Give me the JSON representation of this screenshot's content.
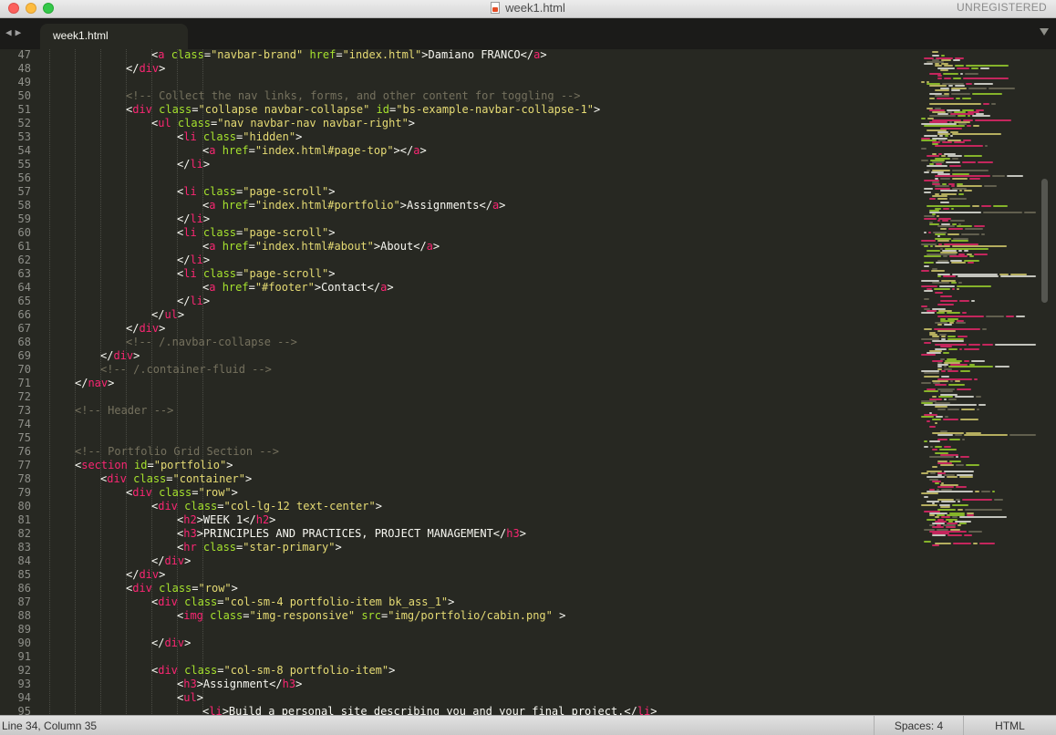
{
  "window": {
    "title": "week1.html",
    "license_status": "UNREGISTERED"
  },
  "tabs": [
    {
      "label": "week1.html",
      "active": true
    }
  ],
  "editor": {
    "lines": [
      {
        "num": "47",
        "indent": 4,
        "tokens": [
          [
            "p",
            "<"
          ],
          [
            "t",
            "a"
          ],
          [
            "a",
            " class"
          ],
          [
            "p",
            "="
          ],
          [
            "s",
            "\"navbar-brand\""
          ],
          [
            "a",
            " href"
          ],
          [
            "p",
            "="
          ],
          [
            "s",
            "\"index.html\""
          ],
          [
            "p",
            ">Damiano FRANCO</"
          ],
          [
            "t",
            "a"
          ],
          [
            "p",
            ">"
          ]
        ]
      },
      {
        "num": "48",
        "indent": 3,
        "tokens": [
          [
            "p",
            "</"
          ],
          [
            "t",
            "div"
          ],
          [
            "p",
            ">"
          ]
        ]
      },
      {
        "num": "49",
        "indent": 0,
        "tokens": []
      },
      {
        "num": "50",
        "indent": 3,
        "tokens": [
          [
            "c",
            "<!-- Collect the nav links, forms, and other content for toggling -->"
          ]
        ]
      },
      {
        "num": "51",
        "indent": 3,
        "tokens": [
          [
            "p",
            "<"
          ],
          [
            "t",
            "div"
          ],
          [
            "a",
            " class"
          ],
          [
            "p",
            "="
          ],
          [
            "s",
            "\"collapse navbar-collapse\""
          ],
          [
            "a",
            " id"
          ],
          [
            "p",
            "="
          ],
          [
            "s",
            "\"bs-example-navbar-collapse-1\""
          ],
          [
            "p",
            ">"
          ]
        ]
      },
      {
        "num": "52",
        "indent": 4,
        "tokens": [
          [
            "p",
            "<"
          ],
          [
            "t",
            "ul"
          ],
          [
            "a",
            " class"
          ],
          [
            "p",
            "="
          ],
          [
            "s",
            "\"nav navbar-nav navbar-right\""
          ],
          [
            "p",
            ">"
          ]
        ]
      },
      {
        "num": "53",
        "indent": 5,
        "tokens": [
          [
            "p",
            "<"
          ],
          [
            "t",
            "li"
          ],
          [
            "a",
            " class"
          ],
          [
            "p",
            "="
          ],
          [
            "s",
            "\"hidden\""
          ],
          [
            "p",
            ">"
          ]
        ]
      },
      {
        "num": "54",
        "indent": 6,
        "tokens": [
          [
            "p",
            "<"
          ],
          [
            "t",
            "a"
          ],
          [
            "a",
            " href"
          ],
          [
            "p",
            "="
          ],
          [
            "s",
            "\"index.html#page-top\""
          ],
          [
            "p",
            "></"
          ],
          [
            "t",
            "a"
          ],
          [
            "p",
            ">"
          ]
        ]
      },
      {
        "num": "55",
        "indent": 5,
        "tokens": [
          [
            "p",
            "</"
          ],
          [
            "t",
            "li"
          ],
          [
            "p",
            ">"
          ]
        ]
      },
      {
        "num": "56",
        "indent": 0,
        "tokens": []
      },
      {
        "num": "57",
        "indent": 5,
        "tokens": [
          [
            "p",
            "<"
          ],
          [
            "t",
            "li"
          ],
          [
            "a",
            " class"
          ],
          [
            "p",
            "="
          ],
          [
            "s",
            "\"page-scroll\""
          ],
          [
            "p",
            ">"
          ]
        ]
      },
      {
        "num": "58",
        "indent": 6,
        "tokens": [
          [
            "p",
            "<"
          ],
          [
            "t",
            "a"
          ],
          [
            "a",
            " href"
          ],
          [
            "p",
            "="
          ],
          [
            "s",
            "\"index.html#portfolio\""
          ],
          [
            "p",
            ">Assignments</"
          ],
          [
            "t",
            "a"
          ],
          [
            "p",
            ">"
          ]
        ]
      },
      {
        "num": "59",
        "indent": 5,
        "tokens": [
          [
            "p",
            "</"
          ],
          [
            "t",
            "li"
          ],
          [
            "p",
            ">"
          ]
        ]
      },
      {
        "num": "60",
        "indent": 5,
        "tokens": [
          [
            "p",
            "<"
          ],
          [
            "t",
            "li"
          ],
          [
            "a",
            " class"
          ],
          [
            "p",
            "="
          ],
          [
            "s",
            "\"page-scroll\""
          ],
          [
            "p",
            ">"
          ]
        ]
      },
      {
        "num": "61",
        "indent": 6,
        "tokens": [
          [
            "p",
            "<"
          ],
          [
            "t",
            "a"
          ],
          [
            "a",
            " href"
          ],
          [
            "p",
            "="
          ],
          [
            "s",
            "\"index.html#about\""
          ],
          [
            "p",
            ">About</"
          ],
          [
            "t",
            "a"
          ],
          [
            "p",
            ">"
          ]
        ]
      },
      {
        "num": "62",
        "indent": 5,
        "tokens": [
          [
            "p",
            "</"
          ],
          [
            "t",
            "li"
          ],
          [
            "p",
            ">"
          ]
        ]
      },
      {
        "num": "63",
        "indent": 5,
        "tokens": [
          [
            "p",
            "<"
          ],
          [
            "t",
            "li"
          ],
          [
            "a",
            " class"
          ],
          [
            "p",
            "="
          ],
          [
            "s",
            "\"page-scroll\""
          ],
          [
            "p",
            ">"
          ]
        ]
      },
      {
        "num": "64",
        "indent": 6,
        "tokens": [
          [
            "p",
            "<"
          ],
          [
            "t",
            "a"
          ],
          [
            "a",
            " href"
          ],
          [
            "p",
            "="
          ],
          [
            "s",
            "\"#footer\""
          ],
          [
            "p",
            ">Contact</"
          ],
          [
            "t",
            "a"
          ],
          [
            "p",
            ">"
          ]
        ]
      },
      {
        "num": "65",
        "indent": 5,
        "tokens": [
          [
            "p",
            "</"
          ],
          [
            "t",
            "li"
          ],
          [
            "p",
            ">"
          ]
        ]
      },
      {
        "num": "66",
        "indent": 4,
        "tokens": [
          [
            "p",
            "</"
          ],
          [
            "t",
            "ul"
          ],
          [
            "p",
            ">"
          ]
        ]
      },
      {
        "num": "67",
        "indent": 3,
        "tokens": [
          [
            "p",
            "</"
          ],
          [
            "t",
            "div"
          ],
          [
            "p",
            ">"
          ]
        ]
      },
      {
        "num": "68",
        "indent": 3,
        "tokens": [
          [
            "c",
            "<!-- /.navbar-collapse -->"
          ]
        ]
      },
      {
        "num": "69",
        "indent": 2,
        "tokens": [
          [
            "p",
            "</"
          ],
          [
            "t",
            "div"
          ],
          [
            "p",
            ">"
          ]
        ]
      },
      {
        "num": "70",
        "indent": 2,
        "tokens": [
          [
            "c",
            "<!-- /.container-fluid -->"
          ]
        ]
      },
      {
        "num": "71",
        "indent": 1,
        "tokens": [
          [
            "p",
            "</"
          ],
          [
            "t",
            "nav"
          ],
          [
            "p",
            ">"
          ]
        ]
      },
      {
        "num": "72",
        "indent": 0,
        "tokens": []
      },
      {
        "num": "73",
        "indent": 1,
        "tokens": [
          [
            "c",
            "<!-- Header -->"
          ]
        ]
      },
      {
        "num": "74",
        "indent": 0,
        "tokens": []
      },
      {
        "num": "75",
        "indent": 0,
        "tokens": []
      },
      {
        "num": "76",
        "indent": 1,
        "tokens": [
          [
            "c",
            "<!-- Portfolio Grid Section -->"
          ]
        ]
      },
      {
        "num": "77",
        "indent": 1,
        "tokens": [
          [
            "p",
            "<"
          ],
          [
            "t",
            "section"
          ],
          [
            "a",
            " id"
          ],
          [
            "p",
            "="
          ],
          [
            "s",
            "\"portfolio\""
          ],
          [
            "p",
            ">"
          ]
        ]
      },
      {
        "num": "78",
        "indent": 2,
        "tokens": [
          [
            "p",
            "<"
          ],
          [
            "t",
            "div"
          ],
          [
            "a",
            " class"
          ],
          [
            "p",
            "="
          ],
          [
            "s",
            "\"container\""
          ],
          [
            "p",
            ">"
          ]
        ]
      },
      {
        "num": "79",
        "indent": 3,
        "tokens": [
          [
            "p",
            "<"
          ],
          [
            "t",
            "div"
          ],
          [
            "a",
            " class"
          ],
          [
            "p",
            "="
          ],
          [
            "s",
            "\"row\""
          ],
          [
            "p",
            ">"
          ]
        ]
      },
      {
        "num": "80",
        "indent": 4,
        "tokens": [
          [
            "p",
            "<"
          ],
          [
            "t",
            "div"
          ],
          [
            "a",
            " class"
          ],
          [
            "p",
            "="
          ],
          [
            "s",
            "\"col-lg-12 text-center\""
          ],
          [
            "p",
            ">"
          ]
        ]
      },
      {
        "num": "81",
        "indent": 5,
        "tokens": [
          [
            "p",
            "<"
          ],
          [
            "t",
            "h2"
          ],
          [
            "p",
            ">WEEK 1</"
          ],
          [
            "t",
            "h2"
          ],
          [
            "p",
            ">"
          ]
        ]
      },
      {
        "num": "82",
        "indent": 5,
        "tokens": [
          [
            "p",
            "<"
          ],
          [
            "t",
            "h3"
          ],
          [
            "p",
            ">PRINCIPLES AND PRACTICES, PROJECT MANAGEMENT</"
          ],
          [
            "t",
            "h3"
          ],
          [
            "p",
            ">"
          ]
        ]
      },
      {
        "num": "83",
        "indent": 5,
        "tokens": [
          [
            "p",
            "<"
          ],
          [
            "t",
            "hr"
          ],
          [
            "a",
            " class"
          ],
          [
            "p",
            "="
          ],
          [
            "s",
            "\"star-primary\""
          ],
          [
            "p",
            ">"
          ]
        ]
      },
      {
        "num": "84",
        "indent": 4,
        "tokens": [
          [
            "p",
            "</"
          ],
          [
            "t",
            "div"
          ],
          [
            "p",
            ">"
          ]
        ]
      },
      {
        "num": "85",
        "indent": 3,
        "tokens": [
          [
            "p",
            "</"
          ],
          [
            "t",
            "div"
          ],
          [
            "p",
            ">"
          ]
        ]
      },
      {
        "num": "86",
        "indent": 3,
        "tokens": [
          [
            "p",
            "<"
          ],
          [
            "t",
            "div"
          ],
          [
            "a",
            " class"
          ],
          [
            "p",
            "="
          ],
          [
            "s",
            "\"row\""
          ],
          [
            "p",
            ">"
          ]
        ]
      },
      {
        "num": "87",
        "indent": 4,
        "tokens": [
          [
            "p",
            "<"
          ],
          [
            "t",
            "div"
          ],
          [
            "a",
            " class"
          ],
          [
            "p",
            "="
          ],
          [
            "s",
            "\"col-sm-4 portfolio-item bk_ass_1\""
          ],
          [
            "p",
            ">"
          ]
        ]
      },
      {
        "num": "88",
        "indent": 5,
        "tokens": [
          [
            "p",
            "<"
          ],
          [
            "t",
            "img"
          ],
          [
            "a",
            " class"
          ],
          [
            "p",
            "="
          ],
          [
            "s",
            "\"img-responsive\""
          ],
          [
            "a",
            " src"
          ],
          [
            "p",
            "="
          ],
          [
            "s",
            "\"img/portfolio/cabin.png\""
          ],
          [
            "p",
            " >"
          ]
        ]
      },
      {
        "num": "89",
        "indent": 0,
        "tokens": []
      },
      {
        "num": "90",
        "indent": 4,
        "tokens": [
          [
            "p",
            "</"
          ],
          [
            "t",
            "div"
          ],
          [
            "p",
            ">"
          ]
        ]
      },
      {
        "num": "91",
        "indent": 0,
        "tokens": []
      },
      {
        "num": "92",
        "indent": 4,
        "tokens": [
          [
            "p",
            "<"
          ],
          [
            "t",
            "div"
          ],
          [
            "a",
            " class"
          ],
          [
            "p",
            "="
          ],
          [
            "s",
            "\"col-sm-8 portfolio-item\""
          ],
          [
            "p",
            ">"
          ]
        ]
      },
      {
        "num": "93",
        "indent": 5,
        "tokens": [
          [
            "p",
            "<"
          ],
          [
            "t",
            "h3"
          ],
          [
            "p",
            ">Assignment</"
          ],
          [
            "t",
            "h3"
          ],
          [
            "p",
            ">"
          ]
        ]
      },
      {
        "num": "94",
        "indent": 5,
        "tokens": [
          [
            "p",
            "<"
          ],
          [
            "t",
            "ul"
          ],
          [
            "p",
            ">"
          ]
        ]
      },
      {
        "num": "95",
        "indent": 6,
        "tokens": [
          [
            "p",
            "<"
          ],
          [
            "t",
            "li"
          ],
          [
            "p",
            ">Build a personal site describing you and your final project.</"
          ],
          [
            "t",
            "li"
          ],
          [
            "p",
            ">"
          ]
        ]
      }
    ]
  },
  "status": {
    "position": "Line 34, Column 35",
    "indentation": "Spaces: 4",
    "syntax": "HTML"
  },
  "icons": {
    "nav": "nav-arrows-icon",
    "menu": "tab-menu-icon",
    "file": "html-file-icon"
  },
  "colors": {
    "background": "#272822",
    "tag": "#f92672",
    "attribute": "#a6e22e",
    "string": "#e6db74",
    "comment": "#75715e",
    "text": "#f8f8f2"
  }
}
